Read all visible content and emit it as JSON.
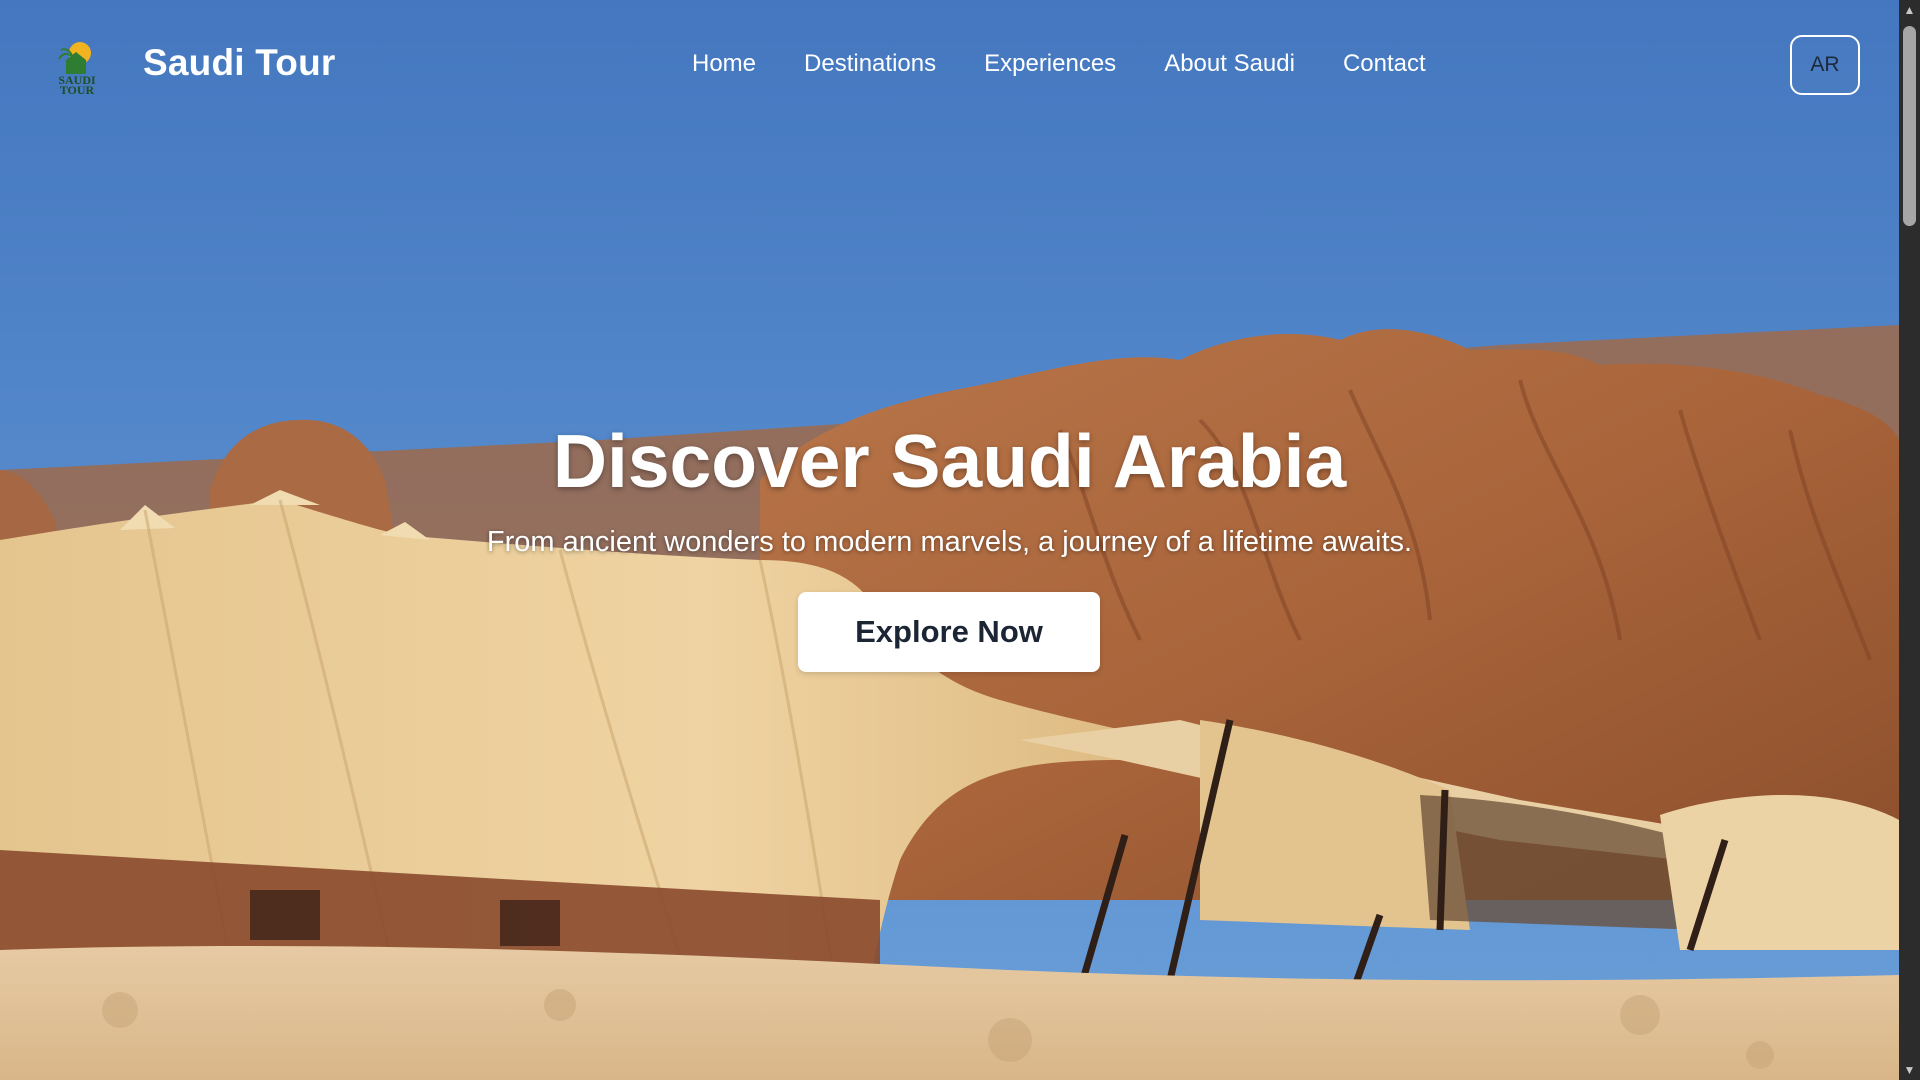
{
  "header": {
    "brand": "Saudi Tour",
    "logo_text_line1": "SAUDI",
    "logo_text_line2": "TOUR",
    "nav": [
      {
        "label": "Home"
      },
      {
        "label": "Destinations"
      },
      {
        "label": "Experiences"
      },
      {
        "label": "About Saudi"
      },
      {
        "label": "Contact"
      }
    ],
    "lang_button": "AR"
  },
  "hero": {
    "title": "Discover Saudi Arabia",
    "subtitle": "From ancient wonders to modern marvels, a journey of a lifetime awaits.",
    "cta_label": "Explore Now"
  },
  "icons": {
    "logo": "saudi-tour-logo-icon",
    "scroll_up": "chevron-up-icon",
    "scroll_down": "chevron-down-icon"
  },
  "colors": {
    "sky": "#4a7fc4",
    "rock": "#b86f45",
    "tent": "#e7c890",
    "sand": "#e2c39b",
    "cta_bg": "#ffffff",
    "cta_text": "#1b2533"
  }
}
